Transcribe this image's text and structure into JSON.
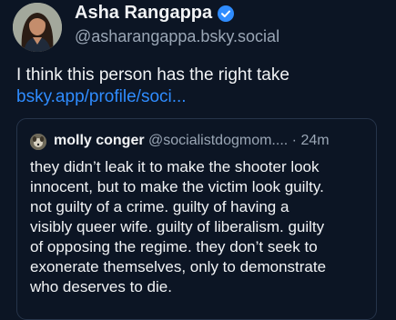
{
  "author": {
    "display_name": "Asha Rangappa",
    "handle": "@asharangappa.bsky.social",
    "avatar_icon": "person-avatar",
    "verified_icon": "verified-check-icon"
  },
  "post": {
    "text": "I think this person has the right take",
    "link": "bsky.app/profile/soci..."
  },
  "quoted_post": {
    "display_name": "molly conger",
    "handle": "@socialistdogmom....",
    "time": "· 24m",
    "lines": [
      "they didn’t leak it to make the shooter look",
      "innocent, but to make the victim look guilty.",
      "not guilty of a crime. guilty of having a",
      "visibly queer wife. guilty of liberalism. guilty",
      "of opposing the regime. they don’t seek to",
      "exonerate themselves, only to demonstrate",
      "who deserves to die."
    ]
  },
  "colors": {
    "background": "#0c1524",
    "link": "#2f8cff",
    "verified": "#2f8cff",
    "muted": "#9aa6b5",
    "border": "#26344a"
  }
}
